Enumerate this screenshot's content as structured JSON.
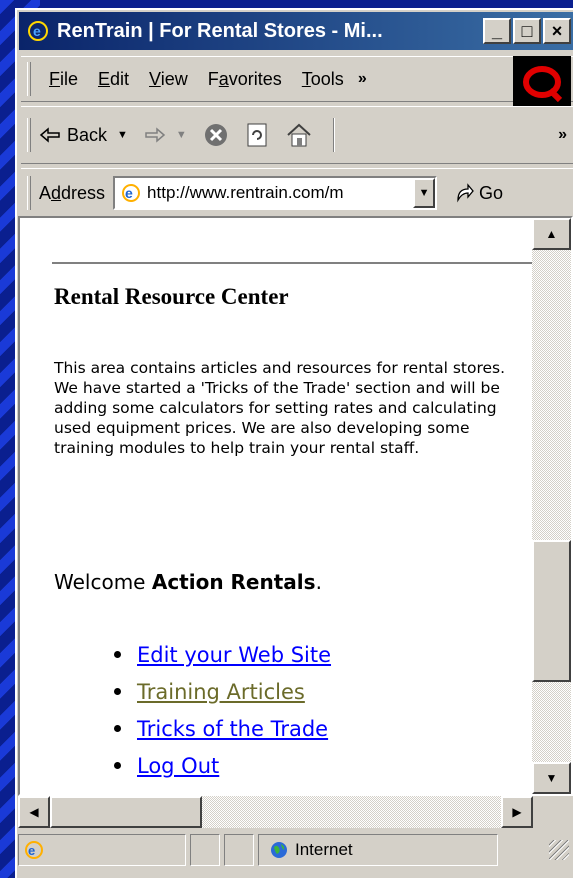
{
  "window": {
    "title": "RenTrain | For Rental Stores - Mi...",
    "minimize": "_",
    "maximize": "□",
    "close": "×"
  },
  "menubar": {
    "items": [
      {
        "accel": "F",
        "rest": "ile"
      },
      {
        "accel": "E",
        "rest": "dit"
      },
      {
        "accel": "V",
        "rest": "iew"
      },
      {
        "pre": "F",
        "accel": "a",
        "rest": "vorites"
      },
      {
        "accel": "T",
        "rest": "ools"
      }
    ],
    "overflow": "»"
  },
  "toolbar": {
    "back_label": "Back",
    "overflow": "»"
  },
  "addressbar": {
    "label_pre": "A",
    "label_accel": "d",
    "label_rest": "dress",
    "url": "http://www.rentrain.com/m",
    "go_label": "Go"
  },
  "page": {
    "title": "Rental Resource Center",
    "description": "This area contains articles and resources for rental stores. We have started a 'Tricks of the Trade' section and will be adding some calculators for setting rates and calculating used equipment prices. We are also developing some training modules to help train your rental staff.",
    "welcome_prefix": "Welcome ",
    "store_name": "Action Rentals",
    "welcome_suffix": ".",
    "links": [
      "Edit your Web Site",
      "Training Articles",
      "Tricks of the Trade",
      "Log Out"
    ]
  },
  "statusbar": {
    "zone": "Internet"
  },
  "colors": {
    "link": "#0000ff",
    "visited_link": "#6b6b2a",
    "titlebar_start": "#0a246a",
    "titlebar_end": "#3a6ea5"
  }
}
